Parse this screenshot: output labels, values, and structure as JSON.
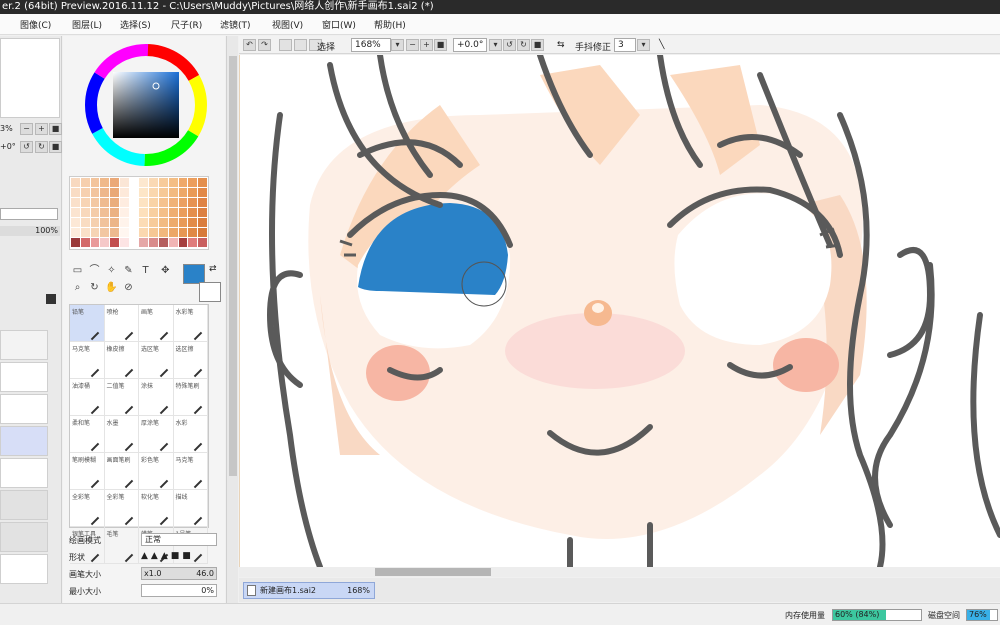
{
  "window": {
    "title": "er.2 (64bit) Preview.2016.11.12 - C:\\Users\\Muddy\\Pictures\\网络人创作\\新手画布1.sai2 (*)"
  },
  "menu": [
    "图像(C)",
    "图层(L)",
    "选择(S)",
    "尺子(R)",
    "滤镜(T)",
    "视图(V)",
    "窗口(W)",
    "帮助(H)"
  ],
  "left_panel": {
    "percent_a": "3%",
    "offset": "+0°",
    "opacity": "100%"
  },
  "canvas_toolbar": {
    "select_label": "选择",
    "zoom": "168%",
    "rotation": "+0.0°",
    "stabilizer_label": "手抖修正",
    "stabilizer_value": "3"
  },
  "color": {
    "current": "#2a82c8",
    "secondary": "#ffffff"
  },
  "brushes": [
    {
      "label": "铅笔",
      "selected": true
    },
    {
      "label": "喷枪",
      "selected": false
    },
    {
      "label": "画笔",
      "selected": false
    },
    {
      "label": "水彩笔",
      "selected": false
    },
    {
      "label": "马克笔",
      "selected": false
    },
    {
      "label": "橡皮擦",
      "selected": false
    },
    {
      "label": "选区笔",
      "selected": false
    },
    {
      "label": "选区擦",
      "selected": false
    },
    {
      "label": "油漆桶",
      "selected": false
    },
    {
      "label": "二值笔",
      "selected": false
    },
    {
      "label": "涂抹",
      "selected": false
    },
    {
      "label": "特殊笔刷",
      "selected": false
    },
    {
      "label": "柔和笔",
      "selected": false
    },
    {
      "label": "水墨",
      "selected": false
    },
    {
      "label": "厚涂笔",
      "selected": false
    },
    {
      "label": "水彩",
      "selected": false
    },
    {
      "label": "笔刷模糊",
      "selected": false
    },
    {
      "label": "画面笔刷",
      "selected": false
    },
    {
      "label": "彩色笔",
      "selected": false
    },
    {
      "label": "马克笔",
      "selected": false
    },
    {
      "label": "全彩笔",
      "selected": false
    },
    {
      "label": "全彩笔",
      "selected": false
    },
    {
      "label": "软化笔",
      "selected": false
    },
    {
      "label": "描线",
      "selected": false
    },
    {
      "label": "银笔工具",
      "selected": false
    },
    {
      "label": "毛笔",
      "selected": false
    },
    {
      "label": "蜡笔",
      "selected": false
    },
    {
      "label": "1号笔",
      "selected": false
    }
  ],
  "brush_props": {
    "blend_label": "绘画模式",
    "blend_value": "正常",
    "shape_label": "形状",
    "size_label": "画笔大小",
    "size_mult": "x1.0",
    "size_value": "46.0",
    "min_label": "最小大小",
    "min_value": "0%"
  },
  "document_tab": {
    "name": "新建画布1.sai2",
    "zoom": "168%"
  },
  "status": {
    "memory_label": "内存使用量",
    "memory_value": "60% (84%)",
    "memory_fraction": 0.6,
    "disk_label": "磁盘空间",
    "disk_value": "76%",
    "disk_fraction": 0.76
  }
}
